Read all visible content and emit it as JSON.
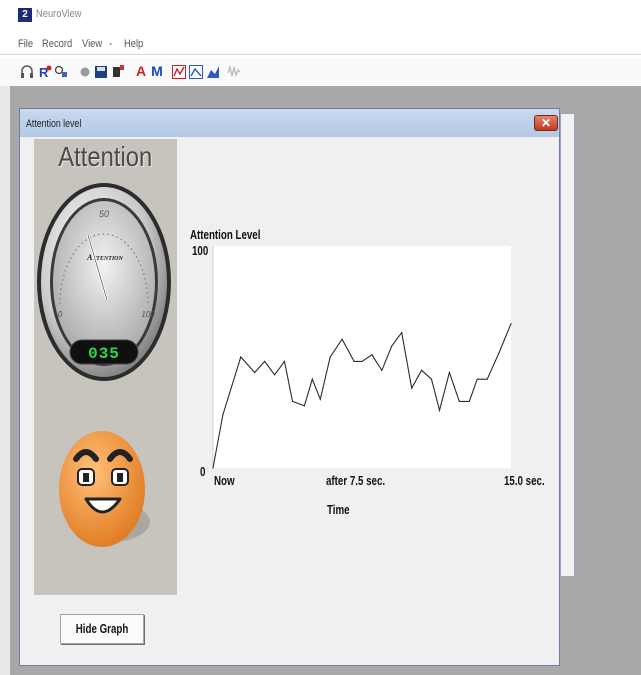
{
  "app": {
    "title": "NeuroView",
    "icon_glyph": "2"
  },
  "menu": [
    "File",
    "Record",
    "View",
    "-",
    "Help"
  ],
  "toolbar": {
    "text_buttons": [
      "A",
      "M"
    ]
  },
  "dialog": {
    "title": "Attention level",
    "close_glyph": "✕",
    "gauge": {
      "heading": "Attention",
      "dial_label": "Attention",
      "scale_min": "0",
      "scale_mid": "50",
      "scale_max": "100",
      "value": 35,
      "display": "035",
      "face": "happy"
    },
    "graph": {
      "title": "Attention Level",
      "y_max_label": "100",
      "y_min_label": "0",
      "x_labels": [
        "Now",
        "after 7.5 sec.",
        "15.0 sec."
      ],
      "xlabel": "Time"
    },
    "hide_graph_label": "Hide Graph"
  },
  "colors": {
    "line": "#2b2b2b",
    "plot_bg": "#ffffff",
    "dialog_bg": "#f0f0f0",
    "titlebar": "#b9cce8",
    "close_button": "#d0553a",
    "display_digits": "#2bd94a",
    "face": "#f29a3c"
  },
  "chart_data": {
    "type": "line",
    "title": "Attention Level",
    "xlabel": "Time",
    "ylabel": "",
    "xlim": [
      0,
      15
    ],
    "ylim": [
      0,
      100
    ],
    "x_ticks": [
      "Now",
      "after 7.5 sec.",
      "15.0 sec."
    ],
    "series": [
      {
        "x": [
          0,
          0.5,
          1.4,
          2.1,
          2.6,
          3.1,
          3.6,
          4.0,
          4.6,
          5.0,
          5.4,
          5.9,
          6.5,
          7.1,
          7.5,
          8.0,
          8.5,
          9.0,
          9.5,
          10.0,
          10.5,
          11.0,
          11.4,
          11.9,
          12.4,
          12.9,
          13.3,
          13.8,
          14.4,
          15.0
        ],
        "y": [
          0,
          24,
          50,
          43,
          48,
          42,
          48,
          30,
          28,
          40,
          31,
          50,
          58,
          48,
          48,
          51,
          44,
          55,
          61,
          36,
          44,
          40,
          26,
          43,
          30,
          30,
          40,
          40,
          52,
          65
        ]
      }
    ],
    "grid": false,
    "legend": "none"
  }
}
